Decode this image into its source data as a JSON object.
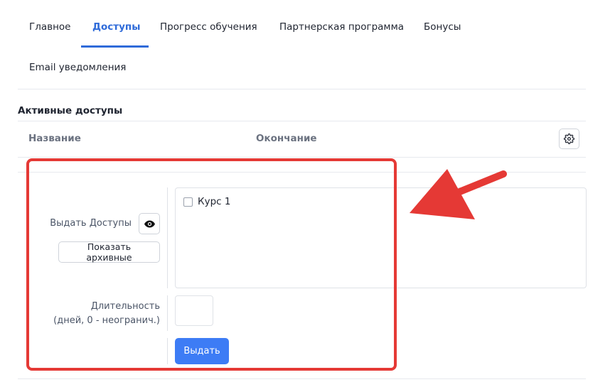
{
  "tabs": [
    {
      "label": "Главное",
      "active": false
    },
    {
      "label": "Доступы",
      "active": true
    },
    {
      "label": "Прогресс обучения",
      "active": false
    },
    {
      "label": "Партнерская программа",
      "active": false
    },
    {
      "label": "Бонусы",
      "active": false
    },
    {
      "label": "Email уведомления",
      "active": false
    }
  ],
  "active_access": {
    "title": "Активные доступы",
    "columns": [
      "Название",
      "Окончание"
    ],
    "settings_icon": "gear-icon"
  },
  "grant_form": {
    "grant_label": "Выдать Доступы",
    "eye_icon": "eye-icon",
    "show_archived_label": "Показать архивные",
    "courses": [
      {
        "label": "Курс 1",
        "checked": false
      }
    ],
    "duration_label_line1": "Длительность",
    "duration_label_line2": "(дней, 0 - неогранич.)",
    "duration_value": "",
    "submit_label": "Выдать"
  },
  "annotation": {
    "highlight_color": "#e53935",
    "arrow_color": "#e53935"
  },
  "colors": {
    "accent": "#2f6bd9",
    "primary_button": "#3d7cf5"
  }
}
